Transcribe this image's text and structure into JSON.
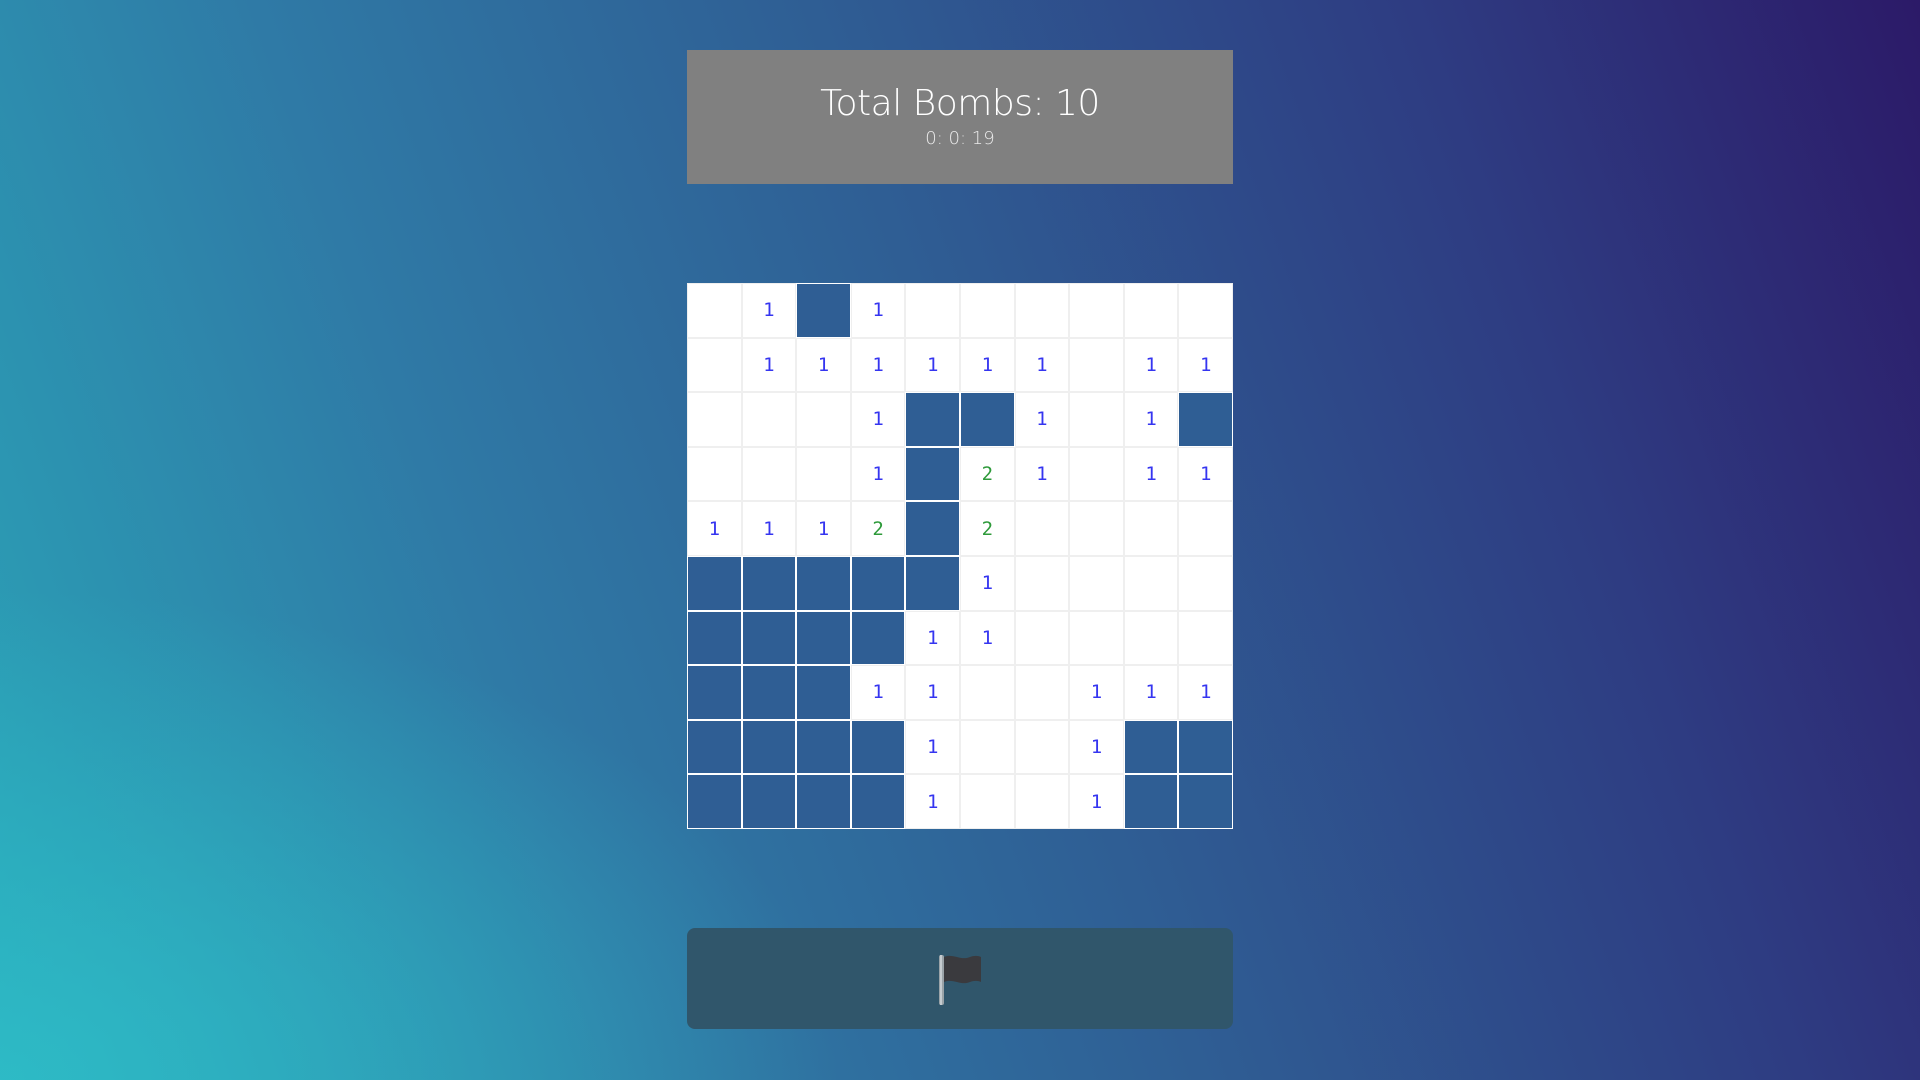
{
  "status": {
    "title": "Total Bombs: 10",
    "timer": "0: 0: 19"
  },
  "board": {
    "rows": 10,
    "cols": 10,
    "cells": [
      [
        "",
        "1",
        "#",
        "1",
        "",
        "",
        "",
        "",
        "",
        ""
      ],
      [
        "",
        "1",
        "1",
        "1",
        "1",
        "1",
        "1",
        "",
        "1",
        "1"
      ],
      [
        "",
        "",
        "",
        "1",
        "#",
        "#",
        "1",
        "",
        "1",
        "#"
      ],
      [
        "",
        "",
        "",
        "1",
        "#",
        "2",
        "1",
        "",
        "1",
        "1"
      ],
      [
        "1",
        "1",
        "1",
        "2",
        "#",
        "2",
        "",
        "",
        "",
        ""
      ],
      [
        "#",
        "#",
        "#",
        "#",
        "#",
        "1",
        "",
        "",
        "",
        ""
      ],
      [
        "#",
        "#",
        "#",
        "#",
        "1",
        "1",
        "",
        "",
        "",
        ""
      ],
      [
        "#",
        "#",
        "#",
        "1",
        "1",
        "",
        "",
        "1",
        "1",
        "1"
      ],
      [
        "#",
        "#",
        "#",
        "#",
        "1",
        "",
        "",
        "1",
        "#",
        "#"
      ],
      [
        "#",
        "#",
        "#",
        "#",
        "1",
        "",
        "",
        "1",
        "#",
        "#"
      ]
    ]
  },
  "flag_button": {
    "icon": "flag-icon"
  },
  "colors": {
    "hidden_cell": "#2f5e94",
    "revealed_cell": "#ffffff",
    "number_1": "#3535f0",
    "number_2": "#2e9a3a",
    "status_panel": "#808080",
    "flag_button": "#30566b"
  }
}
